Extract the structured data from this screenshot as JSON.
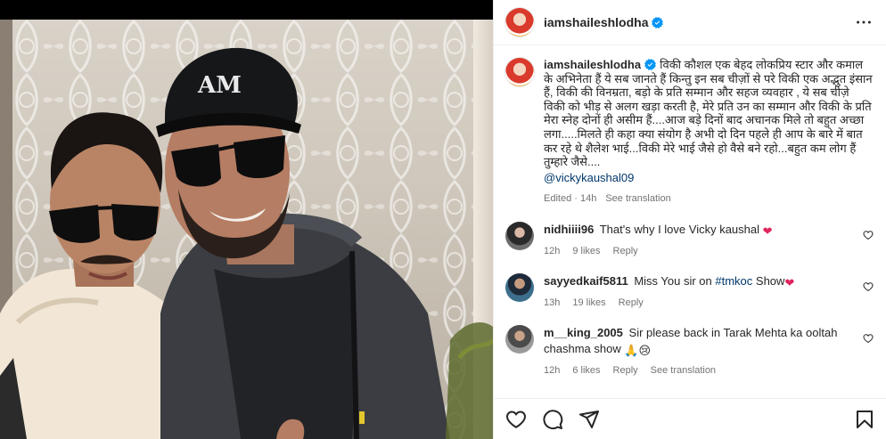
{
  "post": {
    "username": "iamshaileshlodha",
    "verified": true
  },
  "caption": {
    "username": "iamshaileshlodha",
    "text": "विकी कौशल एक बेहद लोकप्रिय स्टार और कमाल के अभिनेता हैं ये सब जानते हैं किन्तु इन सब चीज़ों से परे विकी एक अद्भुत इंसान हैं, विकी की विनम्रता, बड़ो के प्रति सम्मान और सहज व्यवहार , ये सब चीज़े विकी को भीड़ से अलग खड़ा करती है, मेरे प्रति उन का सम्मान और विकी के प्रति मेरा स्नेह दोनों ही असीम हैं....आज बड़े दिनों बाद अचानक मिले तो बहुत अच्छा लगा.....मिलते ही कहा क्या संयोग है अभी दो दिन पहले ही आप के बारे में बात कर रहे थे शैलेश भाई...विकी मेरे भाई जैसे हो वैसे बने रहो...बहुत कम लोग हैं तुम्हारे जैसे....",
    "mention": "@vickykaushal09",
    "edited": "Edited · 14h",
    "see_translation": "See translation"
  },
  "comments": [
    {
      "username": "nidhiiii96",
      "text": "That's why I love Vicky kaushal",
      "emoji": "❤",
      "time": "12h",
      "likes": "9 likes",
      "reply": "Reply"
    },
    {
      "username": "sayyedkaif5811",
      "text_before": "Miss You sir on ",
      "hashtag": "#tmkoc",
      "text_after": " Show",
      "emoji": "❤",
      "time": "13h",
      "likes": "19 likes",
      "reply": "Reply"
    },
    {
      "username": "m__king_2005",
      "text": "Sir please back in Tarak Mehta ka ooltah chashma show",
      "emoji": "🙏😢",
      "time": "12h",
      "likes": "6 likes",
      "reply": "Reply",
      "see_translation": "See translation"
    }
  ],
  "icons": {
    "more": "more-horizontal-icon",
    "like": "heart-icon",
    "comment": "comment-bubble-icon",
    "share": "paper-plane-icon",
    "save": "bookmark-icon"
  },
  "colors": {
    "verified": "#0095f6",
    "link": "#00376b",
    "muted": "#737373",
    "heart_red": "#ed4956"
  }
}
